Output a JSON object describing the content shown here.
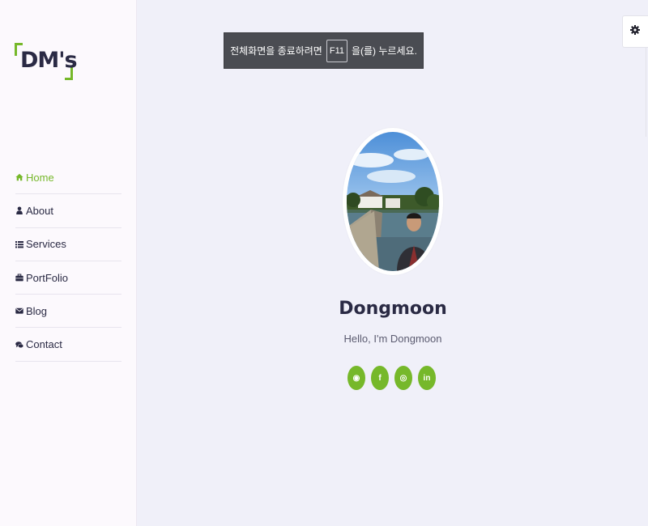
{
  "logo": {
    "text": "DM's"
  },
  "nav": [
    {
      "label": "Home",
      "icon": "home-icon",
      "active": true
    },
    {
      "label": "About",
      "icon": "user-icon"
    },
    {
      "label": "Services",
      "icon": "list-icon"
    },
    {
      "label": "PortFolio",
      "icon": "briefcase-icon"
    },
    {
      "label": "Blog",
      "icon": "envelope-icon"
    },
    {
      "label": "Contact",
      "icon": "comments-icon"
    }
  ],
  "toast": {
    "before": "전체화면을 종료하려면",
    "key": "F11",
    "after": "을(를) 누르세요."
  },
  "profile": {
    "name": "Dongmoon",
    "tagline": "Hello, I'm Dongmoon"
  },
  "socials": [
    {
      "icon": "github-icon",
      "glyph": "◉"
    },
    {
      "icon": "facebook-icon",
      "glyph": "f"
    },
    {
      "icon": "instagram-icon",
      "glyph": "◎"
    },
    {
      "icon": "linkedin-icon",
      "glyph": "in"
    }
  ],
  "colors": {
    "accent": "#76b82a",
    "text": "#2a2a44",
    "background": "#f0f0f9",
    "sidebar": "#fcf9fd"
  }
}
